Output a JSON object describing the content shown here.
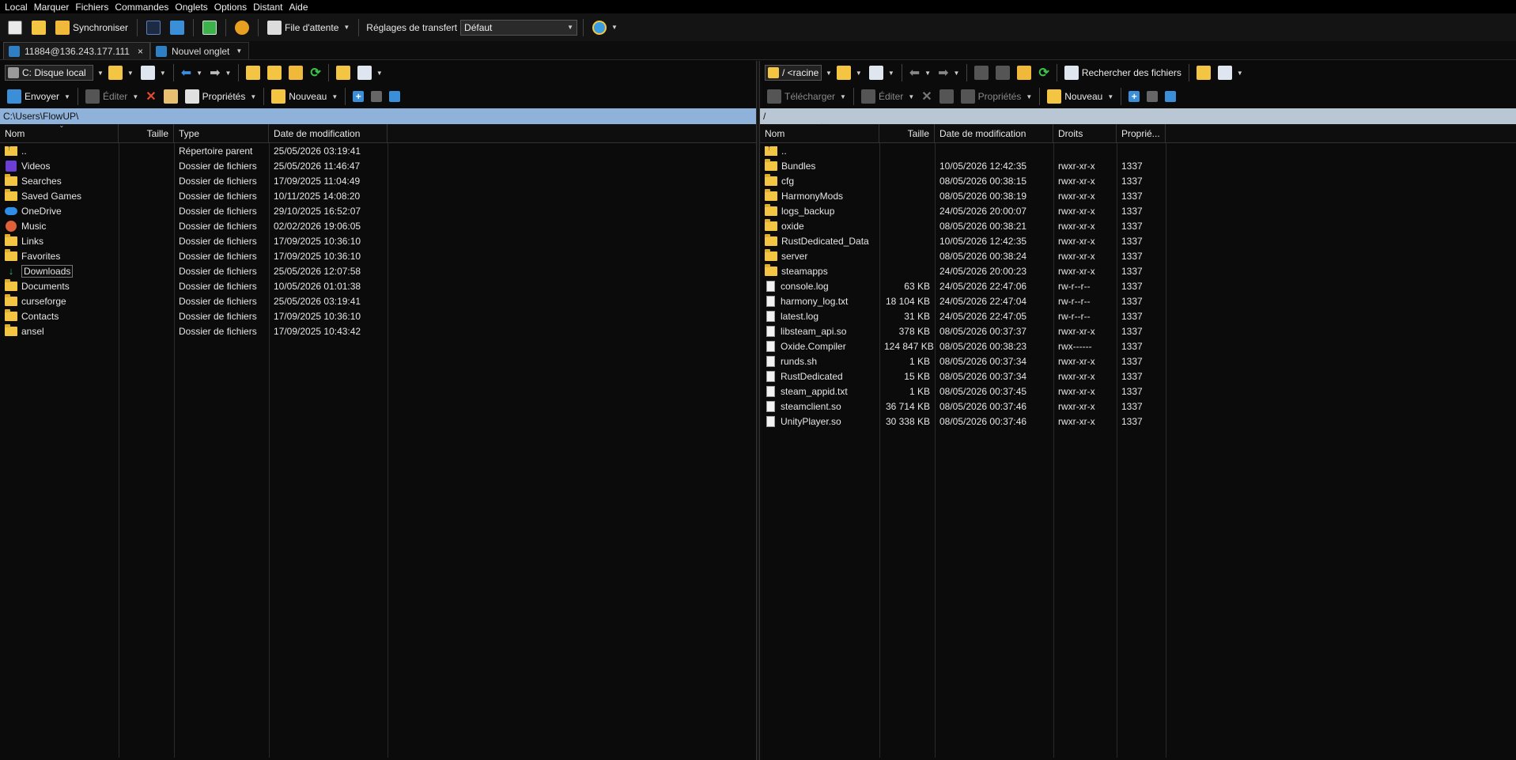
{
  "menu": [
    "Local",
    "Marquer",
    "Fichiers",
    "Commandes",
    "Onglets",
    "Options",
    "Distant",
    "Aide"
  ],
  "toolbar": {
    "sync_label": "Synchroniser",
    "queue_label": "File d'attente",
    "transfer_settings_label": "Réglages de transfert",
    "transfer_preset": "Défaut"
  },
  "tabs": [
    {
      "label": "11884@136.243.177.111",
      "close": "×"
    },
    {
      "label": "Nouvel onglet"
    }
  ],
  "left": {
    "drive": "C: Disque local",
    "actions": {
      "send": "Envoyer",
      "edit": "Éditer",
      "properties": "Propriétés",
      "new": "Nouveau"
    },
    "path": "C:\\Users\\FlowUP\\",
    "columns": {
      "name": "Nom",
      "size": "Taille",
      "type": "Type",
      "modified": "Date de modification"
    },
    "rows": [
      {
        "icon": "up-folder-icon",
        "name": "..",
        "size": "",
        "type": "Répertoire parent",
        "modified": "25/05/2026 03:19:41"
      },
      {
        "icon": "videos-icon",
        "name": "Videos",
        "size": "",
        "type": "Dossier de fichiers",
        "modified": "25/05/2026 11:46:47"
      },
      {
        "icon": "folder-icon",
        "name": "Searches",
        "size": "",
        "type": "Dossier de fichiers",
        "modified": "17/09/2025 11:04:49"
      },
      {
        "icon": "folder-icon",
        "name": "Saved Games",
        "size": "",
        "type": "Dossier de fichiers",
        "modified": "10/11/2025 14:08:20"
      },
      {
        "icon": "onedrive-icon",
        "name": "OneDrive",
        "size": "",
        "type": "Dossier de fichiers",
        "modified": "29/10/2025 16:52:07"
      },
      {
        "icon": "music-icon",
        "name": "Music",
        "size": "",
        "type": "Dossier de fichiers",
        "modified": "02/02/2026 19:06:05"
      },
      {
        "icon": "folder-icon",
        "name": "Links",
        "size": "",
        "type": "Dossier de fichiers",
        "modified": "17/09/2025 10:36:10"
      },
      {
        "icon": "folder-icon",
        "name": "Favorites",
        "size": "",
        "type": "Dossier de fichiers",
        "modified": "17/09/2025 10:36:10"
      },
      {
        "icon": "downloads-icon",
        "name": "Downloads",
        "size": "",
        "type": "Dossier de fichiers",
        "modified": "25/05/2026 12:07:58"
      },
      {
        "icon": "folder-icon",
        "name": "Documents",
        "size": "",
        "type": "Dossier de fichiers",
        "modified": "10/05/2026 01:01:38"
      },
      {
        "icon": "folder-icon",
        "name": "curseforge",
        "size": "",
        "type": "Dossier de fichiers",
        "modified": "25/05/2026 03:19:41"
      },
      {
        "icon": "folder-icon",
        "name": "Contacts",
        "size": "",
        "type": "Dossier de fichiers",
        "modified": "17/09/2025 10:36:10"
      },
      {
        "icon": "folder-icon",
        "name": "ansel",
        "size": "",
        "type": "Dossier de fichiers",
        "modified": "17/09/2025 10:43:42"
      }
    ]
  },
  "right": {
    "root": "/ <racine>",
    "search_label": "Rechercher des fichiers",
    "actions": {
      "download": "Télécharger",
      "edit": "Éditer",
      "properties": "Propriétés",
      "new": "Nouveau"
    },
    "path": "/",
    "columns": {
      "name": "Nom",
      "size": "Taille",
      "modified": "Date de modification",
      "rights": "Droits",
      "owner": "Proprié..."
    },
    "rows": [
      {
        "icon": "up-folder-icon",
        "name": "..",
        "size": "",
        "modified": "",
        "rights": "",
        "owner": ""
      },
      {
        "icon": "folder-icon",
        "name": "Bundles",
        "size": "",
        "modified": "10/05/2026 12:42:35",
        "rights": "rwxr-xr-x",
        "owner": "1337"
      },
      {
        "icon": "folder-icon",
        "name": "cfg",
        "size": "",
        "modified": "08/05/2026 00:38:15",
        "rights": "rwxr-xr-x",
        "owner": "1337"
      },
      {
        "icon": "folder-icon",
        "name": "HarmonyMods",
        "size": "",
        "modified": "08/05/2026 00:38:19",
        "rights": "rwxr-xr-x",
        "owner": "1337"
      },
      {
        "icon": "folder-icon",
        "name": "logs_backup",
        "size": "",
        "modified": "24/05/2026 20:00:07",
        "rights": "rwxr-xr-x",
        "owner": "1337"
      },
      {
        "icon": "folder-icon",
        "name": "oxide",
        "size": "",
        "modified": "08/05/2026 00:38:21",
        "rights": "rwxr-xr-x",
        "owner": "1337"
      },
      {
        "icon": "folder-icon",
        "name": "RustDedicated_Data",
        "size": "",
        "modified": "10/05/2026 12:42:35",
        "rights": "rwxr-xr-x",
        "owner": "1337"
      },
      {
        "icon": "folder-icon",
        "name": "server",
        "size": "",
        "modified": "08/05/2026 00:38:24",
        "rights": "rwxr-xr-x",
        "owner": "1337"
      },
      {
        "icon": "folder-icon",
        "name": "steamapps",
        "size": "",
        "modified": "24/05/2026 20:00:23",
        "rights": "rwxr-xr-x",
        "owner": "1337"
      },
      {
        "icon": "file-icon",
        "name": "console.log",
        "size": "63 KB",
        "modified": "24/05/2026 22:47:06",
        "rights": "rw-r--r--",
        "owner": "1337"
      },
      {
        "icon": "file-icon",
        "name": "harmony_log.txt",
        "size": "18 104 KB",
        "modified": "24/05/2026 22:47:04",
        "rights": "rw-r--r--",
        "owner": "1337"
      },
      {
        "icon": "file-icon",
        "name": "latest.log",
        "size": "31 KB",
        "modified": "24/05/2026 22:47:05",
        "rights": "rw-r--r--",
        "owner": "1337"
      },
      {
        "icon": "file-icon",
        "name": "libsteam_api.so",
        "size": "378 KB",
        "modified": "08/05/2026 00:37:37",
        "rights": "rwxr-xr-x",
        "owner": "1337"
      },
      {
        "icon": "file-icon",
        "name": "Oxide.Compiler",
        "size": "124 847 KB",
        "modified": "08/05/2026 00:38:23",
        "rights": "rwx------",
        "owner": "1337"
      },
      {
        "icon": "file-icon",
        "name": "runds.sh",
        "size": "1 KB",
        "modified": "08/05/2026 00:37:34",
        "rights": "rwxr-xr-x",
        "owner": "1337"
      },
      {
        "icon": "file-icon",
        "name": "RustDedicated",
        "size": "15 KB",
        "modified": "08/05/2026 00:37:34",
        "rights": "rwxr-xr-x",
        "owner": "1337"
      },
      {
        "icon": "file-icon",
        "name": "steam_appid.txt",
        "size": "1 KB",
        "modified": "08/05/2026 00:37:45",
        "rights": "rwxr-xr-x",
        "owner": "1337"
      },
      {
        "icon": "file-icon",
        "name": "steamclient.so",
        "size": "36 714 KB",
        "modified": "08/05/2026 00:37:46",
        "rights": "rwxr-xr-x",
        "owner": "1337"
      },
      {
        "icon": "file-icon",
        "name": "UnityPlayer.so",
        "size": "30 338 KB",
        "modified": "08/05/2026 00:37:46",
        "rights": "rwxr-xr-x",
        "owner": "1337"
      }
    ]
  }
}
